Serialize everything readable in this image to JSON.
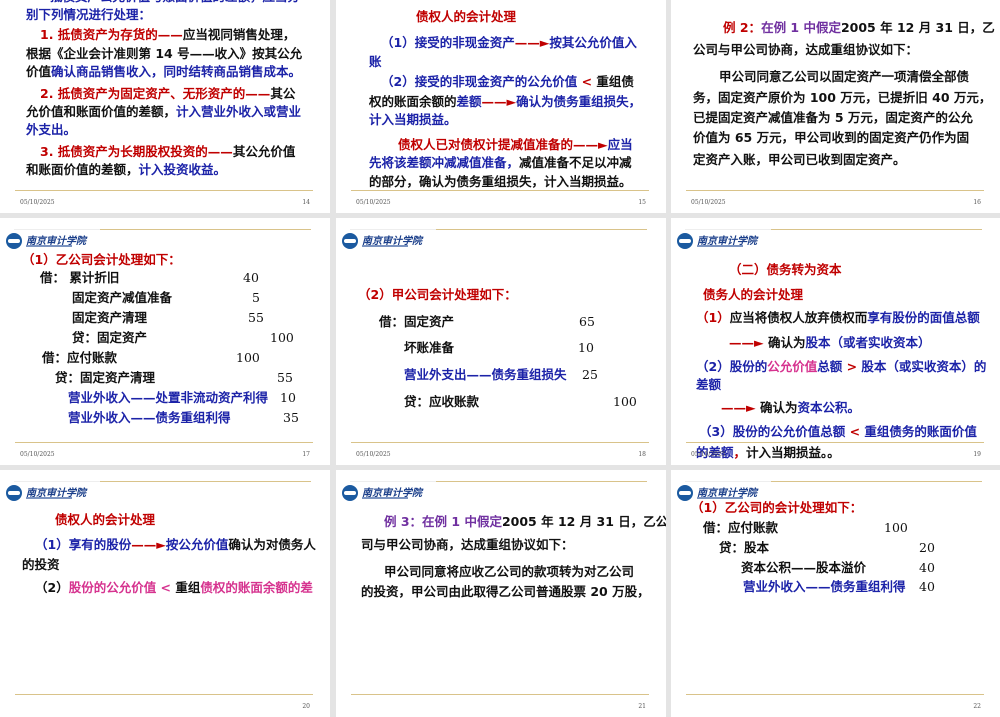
{
  "colors": {
    "k": "#111111",
    "r": "#c00000",
    "b": "#1c23a8",
    "p": "#7030a0",
    "m": "#d6338f",
    "gold": "#d9c38a"
  },
  "logo_text": "南京审计学院",
  "slides": [
    {
      "number": "14",
      "date": "05/10/2025",
      "logo": false,
      "lines": [
        {
          "segs": [
            [
              "抵债资产公允价值与账面价值的差额，应当分",
              "b"
            ]
          ]
        },
        {
          "segs": [
            [
              "别下列情况进行处理：",
              "b"
            ]
          ]
        },
        {
          "segs": [
            [
              "1. 抵债资产为存货的——",
              "r"
            ],
            [
              "应当视同销售处理，",
              "k"
            ]
          ]
        },
        {
          "segs": [
            [
              "根据《企业会计准则第 14 号——收入》按其公允",
              "k"
            ]
          ]
        },
        {
          "segs": [
            [
              "价值",
              "k"
            ],
            [
              "确认商品销售收入，同时结转商品销售成本。",
              "b"
            ]
          ]
        },
        {
          "segs": [
            [
              "2. 抵债资产为固定资产、无形资产的——",
              "r"
            ],
            [
              "其公",
              "k"
            ]
          ]
        },
        {
          "segs": [
            [
              "允价值和账面价值的差额，",
              "k"
            ],
            [
              "计入营业外收入或营业",
              "b"
            ]
          ]
        },
        {
          "segs": [
            [
              "外支出。",
              "b"
            ]
          ]
        },
        {
          "segs": [
            [
              "3. 抵债资产为长期股权投资的——",
              "r"
            ],
            [
              "其公允价值",
              "k"
            ]
          ]
        },
        {
          "segs": [
            [
              "和账面价值的差额，",
              "k"
            ],
            [
              "计入投资收益。",
              "b"
            ]
          ]
        }
      ]
    },
    {
      "number": "15",
      "date": "05/10/2025",
      "logo": false,
      "lines": [
        {
          "segs": [
            [
              "债权人的会计处理",
              "r"
            ]
          ]
        },
        {
          "segs": [
            [
              "（1）接受的非现金资产",
              "b"
            ],
            [
              "——►",
              "r"
            ],
            [
              "按其公允价值入",
              "b"
            ]
          ]
        },
        {
          "segs": [
            [
              "账",
              "b"
            ]
          ]
        },
        {
          "segs": [
            [
              "（2）接受的非现金资产的公允价值 ",
              "b"
            ],
            [
              "<",
              "r"
            ],
            [
              " 重组债",
              "k"
            ]
          ]
        },
        {
          "segs": [
            [
              "权的账面余额的",
              "k"
            ],
            [
              "差额",
              "b"
            ],
            [
              "——►",
              "r"
            ],
            [
              "确认为债务重组损失，",
              "b"
            ]
          ]
        },
        {
          "segs": [
            [
              "计入当期损益。",
              "b"
            ]
          ]
        },
        {
          "segs": [
            [
              "债权人已对债权计提减值准备的",
              "r"
            ],
            [
              "——►",
              "r"
            ],
            [
              "应当",
              "b"
            ]
          ]
        },
        {
          "segs": [
            [
              "先将该差额冲减减值准备，",
              "b"
            ],
            [
              "减值准备不足以冲减",
              "k"
            ]
          ]
        },
        {
          "segs": [
            [
              "的部分，确认为债务重组损失，计入当期损益。",
              "k"
            ]
          ]
        }
      ]
    },
    {
      "number": "16",
      "date": "05/10/2025",
      "logo": false,
      "lines": [
        {
          "segs": [
            [
              "例 2：",
              "r"
            ],
            [
              "在例 1 中假定",
              "p"
            ],
            [
              "2005 年 12 月 31 日，乙",
              "k"
            ]
          ]
        },
        {
          "segs": [
            [
              "公司与甲公司协商，达成重组协议如下：",
              "k"
            ]
          ]
        },
        {
          "segs": [
            [
              "甲公司同意乙公司以固定资产一项清偿全部债",
              "k"
            ]
          ]
        },
        {
          "segs": [
            [
              "务，固定资产原价为 100 万元，已提折旧 40 万元，",
              "k"
            ]
          ]
        },
        {
          "segs": [
            [
              "已提固定资产减值准备为 5 万元，固定资产的公允",
              "k"
            ]
          ]
        },
        {
          "segs": [
            [
              "价值为 65 万元，甲公司收到的固定资产仍作为固",
              "k"
            ]
          ]
        },
        {
          "segs": [
            [
              "定资产入账，甲公司已收到固定资产。",
              "k"
            ]
          ]
        }
      ]
    },
    {
      "number": "17",
      "date": "05/10/2025",
      "logo": true,
      "lines": [
        {
          "segs": [
            [
              "（1）乙公司会计处理如下：",
              "r"
            ]
          ]
        },
        {
          "segs": [
            [
              "借：  累计折旧",
              "k"
            ]
          ],
          "amount": "40"
        },
        {
          "segs": [
            [
              "固定资产减值准备",
              "k"
            ]
          ],
          "amount": "5"
        },
        {
          "segs": [
            [
              "固定资产清理",
              "k"
            ]
          ],
          "amount": "55"
        },
        {
          "segs": [
            [
              "贷：固定资产",
              "k"
            ]
          ],
          "amount": "100"
        },
        {
          "segs": [
            [
              "借：应付账款",
              "k"
            ]
          ],
          "amount": "100"
        },
        {
          "segs": [
            [
              "贷：固定资产清理",
              "k"
            ]
          ],
          "amount": "55"
        },
        {
          "segs": [
            [
              "营业外收入——处置非流动资产利得",
              "b"
            ]
          ],
          "amount": "10"
        },
        {
          "segs": [
            [
              "营业外收入——债务重组利得",
              "b"
            ]
          ],
          "amount": "35"
        }
      ]
    },
    {
      "number": "18",
      "date": "05/10/2025",
      "logo": true,
      "lines": [
        {
          "segs": [
            [
              "（2）甲公司会计处理如下：",
              "r"
            ]
          ]
        },
        {
          "segs": [
            [
              "借：固定资产",
              "k"
            ]
          ],
          "amount": "65"
        },
        {
          "segs": [
            [
              "坏账准备",
              "k"
            ]
          ],
          "amount": "10"
        },
        {
          "segs": [
            [
              "营业外支出——债务重组损失",
              "b"
            ]
          ],
          "amount": "25"
        },
        {
          "segs": [
            [
              "贷：应收账款",
              "k"
            ]
          ],
          "amount": "100"
        }
      ]
    },
    {
      "number": "19",
      "date": "05/10/2025",
      "logo": true,
      "lines": [
        {
          "segs": [
            [
              "（二）债务转为资本",
              "r"
            ]
          ]
        },
        {
          "segs": [
            [
              "债务人的会计处理",
              "r"
            ]
          ]
        },
        {
          "segs": [
            [
              "（1）",
              "r"
            ],
            [
              "应当将债权人放弃债权而",
              "k"
            ],
            [
              "享有股份的面值总额",
              "b"
            ]
          ]
        },
        {
          "segs": [
            [
              "——►",
              "r"
            ],
            [
              " 确认为",
              "k"
            ],
            [
              "股本（或者实收资本）",
              "b"
            ]
          ]
        },
        {
          "segs": [
            [
              "（2）股份的",
              "b"
            ],
            [
              "公允价值",
              "m"
            ],
            [
              "总额 ",
              "b"
            ],
            [
              ">",
              "r"
            ],
            [
              " 股本（或实收资本）的",
              "b"
            ]
          ]
        },
        {
          "segs": [
            [
              "差额",
              "b"
            ]
          ]
        },
        {
          "segs": [
            [
              "——►",
              "r"
            ],
            [
              " 确认为",
              "k"
            ],
            [
              "资本公积。",
              "b"
            ]
          ]
        },
        {
          "segs": [
            [
              "（3）股份的公允价值总额 ",
              "b"
            ],
            [
              "<",
              "r"
            ],
            [
              " 重组债务的账面价值",
              "b"
            ]
          ]
        },
        {
          "segs": [
            [
              "的差额",
              "b"
            ],
            [
              "，",
              "r"
            ],
            [
              "计入当期损益。。",
              "k"
            ]
          ]
        }
      ]
    },
    {
      "number": "20",
      "date": "",
      "logo": true,
      "lines": [
        {
          "segs": [
            [
              "债权人的会计处理",
              "r"
            ]
          ]
        },
        {
          "segs": [
            [
              "（1）享有的股份",
              "b"
            ],
            [
              "——►",
              "r"
            ],
            [
              "按公允价值",
              "b"
            ],
            [
              "确认为对债务人",
              "k"
            ]
          ]
        },
        {
          "segs": [
            [
              "的投资",
              "k"
            ]
          ]
        },
        {
          "segs": [
            [
              "（2）",
              "k"
            ],
            [
              "股份的公允价值 < ",
              "m"
            ],
            [
              "重组",
              "k"
            ],
            [
              "债权的账面余额的差",
              "m"
            ]
          ]
        }
      ]
    },
    {
      "number": "21",
      "date": "",
      "logo": true,
      "lines": [
        {
          "segs": [
            [
              "例 3：在例 1 中假定",
              "p"
            ],
            [
              "2005 年 12 月 31 日，乙公",
              "k"
            ]
          ]
        },
        {
          "segs": [
            [
              "司与甲公司协商，达成重组协议如下：",
              "k"
            ]
          ]
        },
        {
          "segs": [
            [
              "甲公司同意将应收乙公司的款项转为对乙公司",
              "k"
            ]
          ]
        },
        {
          "segs": [
            [
              "的投资，甲公司由此取得乙公司普通股票 20 万股，",
              "k"
            ]
          ]
        }
      ]
    },
    {
      "number": "22",
      "date": "",
      "logo": true,
      "lines": [
        {
          "segs": [
            [
              "（1）乙公司的会计处理如下：",
              "r"
            ]
          ]
        },
        {
          "segs": [
            [
              "借：应付账款",
              "k"
            ]
          ],
          "amount": "100"
        },
        {
          "segs": [
            [
              "贷：股本",
              "k"
            ]
          ],
          "amount": "20"
        },
        {
          "segs": [
            [
              "资本公积——股本溢价",
              "k"
            ]
          ],
          "amount": "40"
        },
        {
          "segs": [
            [
              "营业外收入——债务重组利得",
              "b"
            ]
          ],
          "amount": "40"
        }
      ]
    }
  ]
}
